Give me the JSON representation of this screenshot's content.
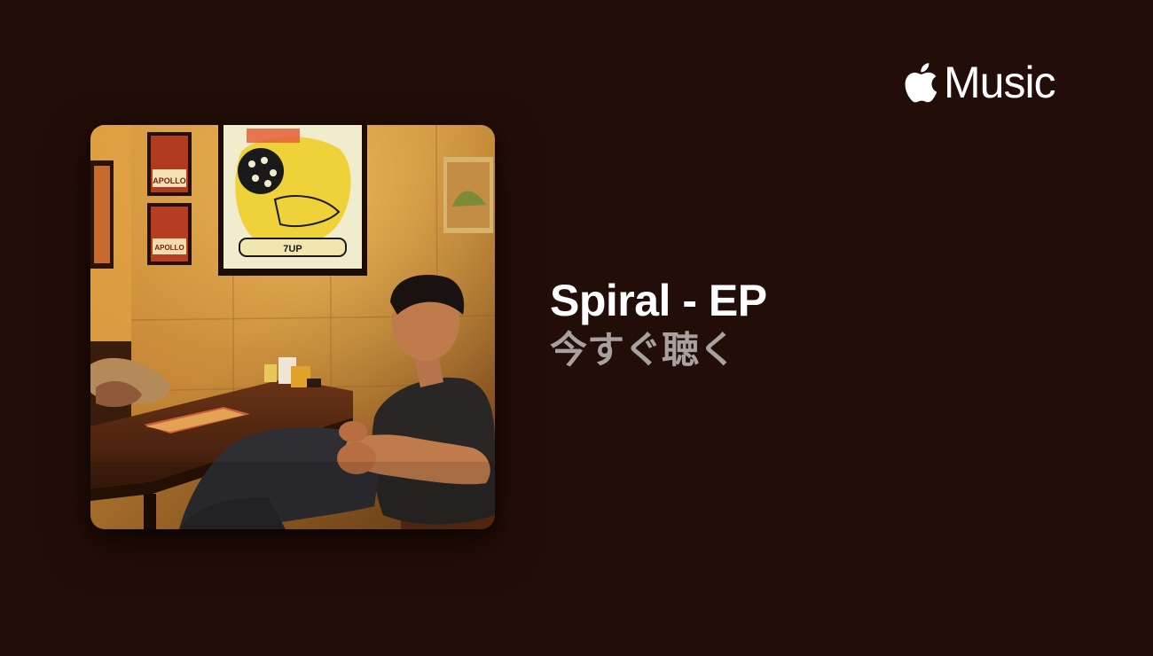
{
  "brand": {
    "icon": "apple-logo-icon",
    "name": "Music"
  },
  "album": {
    "title": "Spiral - EP",
    "cta_label": "今すぐ聴く"
  },
  "artwork": {
    "poster_text": "APOLLO",
    "poster_text_2": "APOLLO",
    "sign_text": "7UP"
  },
  "colors": {
    "background": "#230d08",
    "title": "#ffffff",
    "cta": "#a8a19f"
  }
}
